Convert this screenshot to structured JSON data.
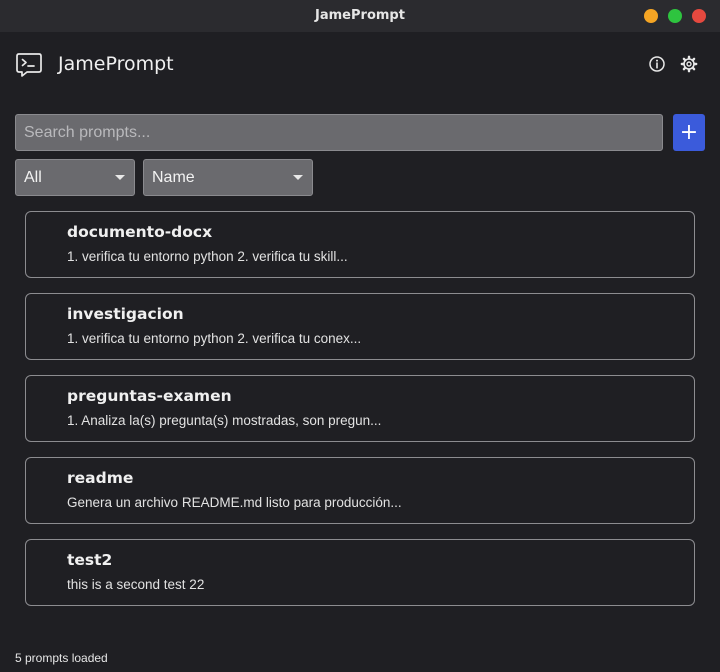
{
  "window": {
    "title": "JamePrompt",
    "controls": {
      "minimize_color": "#f5a524",
      "maximize_color": "#2ec43f",
      "close_color": "#e5493f"
    }
  },
  "header": {
    "app_name": "JamePrompt",
    "logo_icon": "terminal-chat-icon",
    "info_icon": "info-icon",
    "settings_icon": "gear-icon"
  },
  "search": {
    "placeholder": "Search prompts...",
    "value": ""
  },
  "add_button": {
    "label": "+",
    "color": "#3b5bdb"
  },
  "filters": {
    "category_selected": "All",
    "sort_selected": "Name"
  },
  "prompts": [
    {
      "title": "documento-docx",
      "preview": "1. verifica tu entorno python 2. verifica tu skill..."
    },
    {
      "title": "investigacion",
      "preview": "1. verifica tu entorno python 2. verifica tu conex..."
    },
    {
      "title": "preguntas-examen",
      "preview": "1. Analiza la(s) pregunta(s) mostradas, son pregun..."
    },
    {
      "title": "readme",
      "preview": "Genera un archivo README.md listo para producción..."
    },
    {
      "title": "test2",
      "preview": "this is a second test 22"
    }
  ],
  "status": {
    "text": "5 prompts loaded"
  }
}
